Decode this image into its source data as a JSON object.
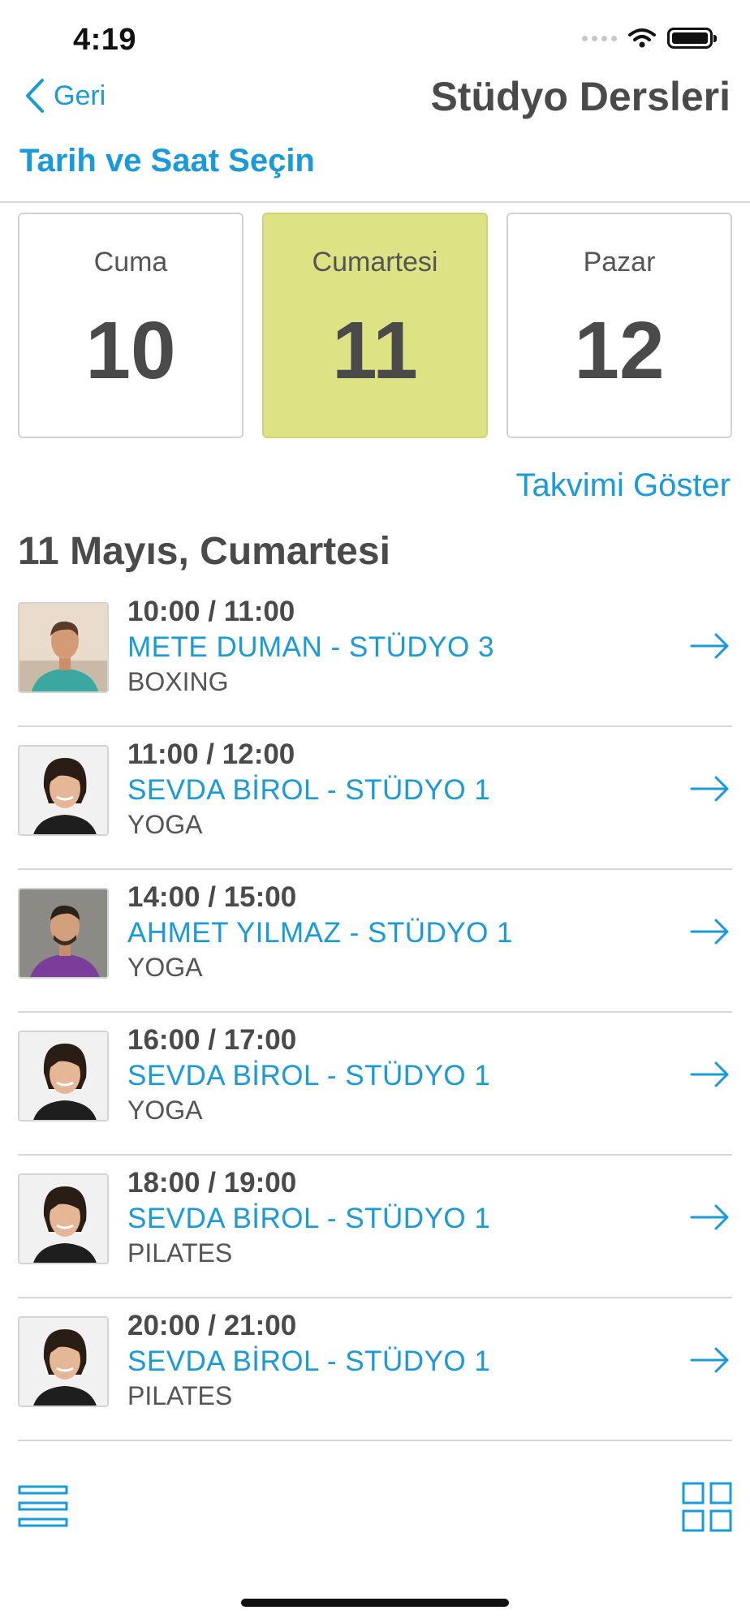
{
  "status_bar": {
    "time": "4:19"
  },
  "nav": {
    "back_label": "Geri",
    "title": "Stüdyo Dersleri"
  },
  "section_label": "Tarih ve Saat Seçin",
  "days": [
    {
      "name": "Cuma",
      "number": "10",
      "selected": false
    },
    {
      "name": "Cumartesi",
      "number": "11",
      "selected": true
    },
    {
      "name": "Pazar",
      "number": "12",
      "selected": false
    }
  ],
  "calendar_link": "Takvimi Göster",
  "date_heading": "11 Mayıs, Cumartesi",
  "lessons": [
    {
      "time": "10:00 / 11:00",
      "coach": "METE DUMAN - STÜDYO 3",
      "type": "BOXING",
      "avatar": "man-teal-shirt-photo"
    },
    {
      "time": "11:00 / 12:00",
      "coach": "SEVDA BİROL - STÜDYO 1",
      "type": "YOGA",
      "avatar": "woman-dark-hair-photo"
    },
    {
      "time": "14:00 / 15:00",
      "coach": "AHMET YILMAZ - STÜDYO 1",
      "type": "YOGA",
      "avatar": "man-purple-shirt-photo"
    },
    {
      "time": "16:00 / 17:00",
      "coach": "SEVDA BİROL - STÜDYO 1",
      "type": "YOGA",
      "avatar": "woman-dark-hair-photo"
    },
    {
      "time": "18:00 / 19:00",
      "coach": "SEVDA BİROL - STÜDYO 1",
      "type": "PILATES",
      "avatar": "woman-dark-hair-photo"
    },
    {
      "time": "20:00 / 21:00",
      "coach": "SEVDA BİROL - STÜDYO 1",
      "type": "PILATES",
      "avatar": "woman-dark-hair-photo"
    }
  ],
  "colors": {
    "accent": "#1a9ad9",
    "selected_day": "#dde285",
    "text": "#4a4a4a",
    "divider": "#d6d6d6"
  },
  "icons": [
    "chevron-left-icon",
    "arrow-right-icon",
    "list-view-icon",
    "grid-view-icon",
    "wifi-icon",
    "battery-icon"
  ]
}
